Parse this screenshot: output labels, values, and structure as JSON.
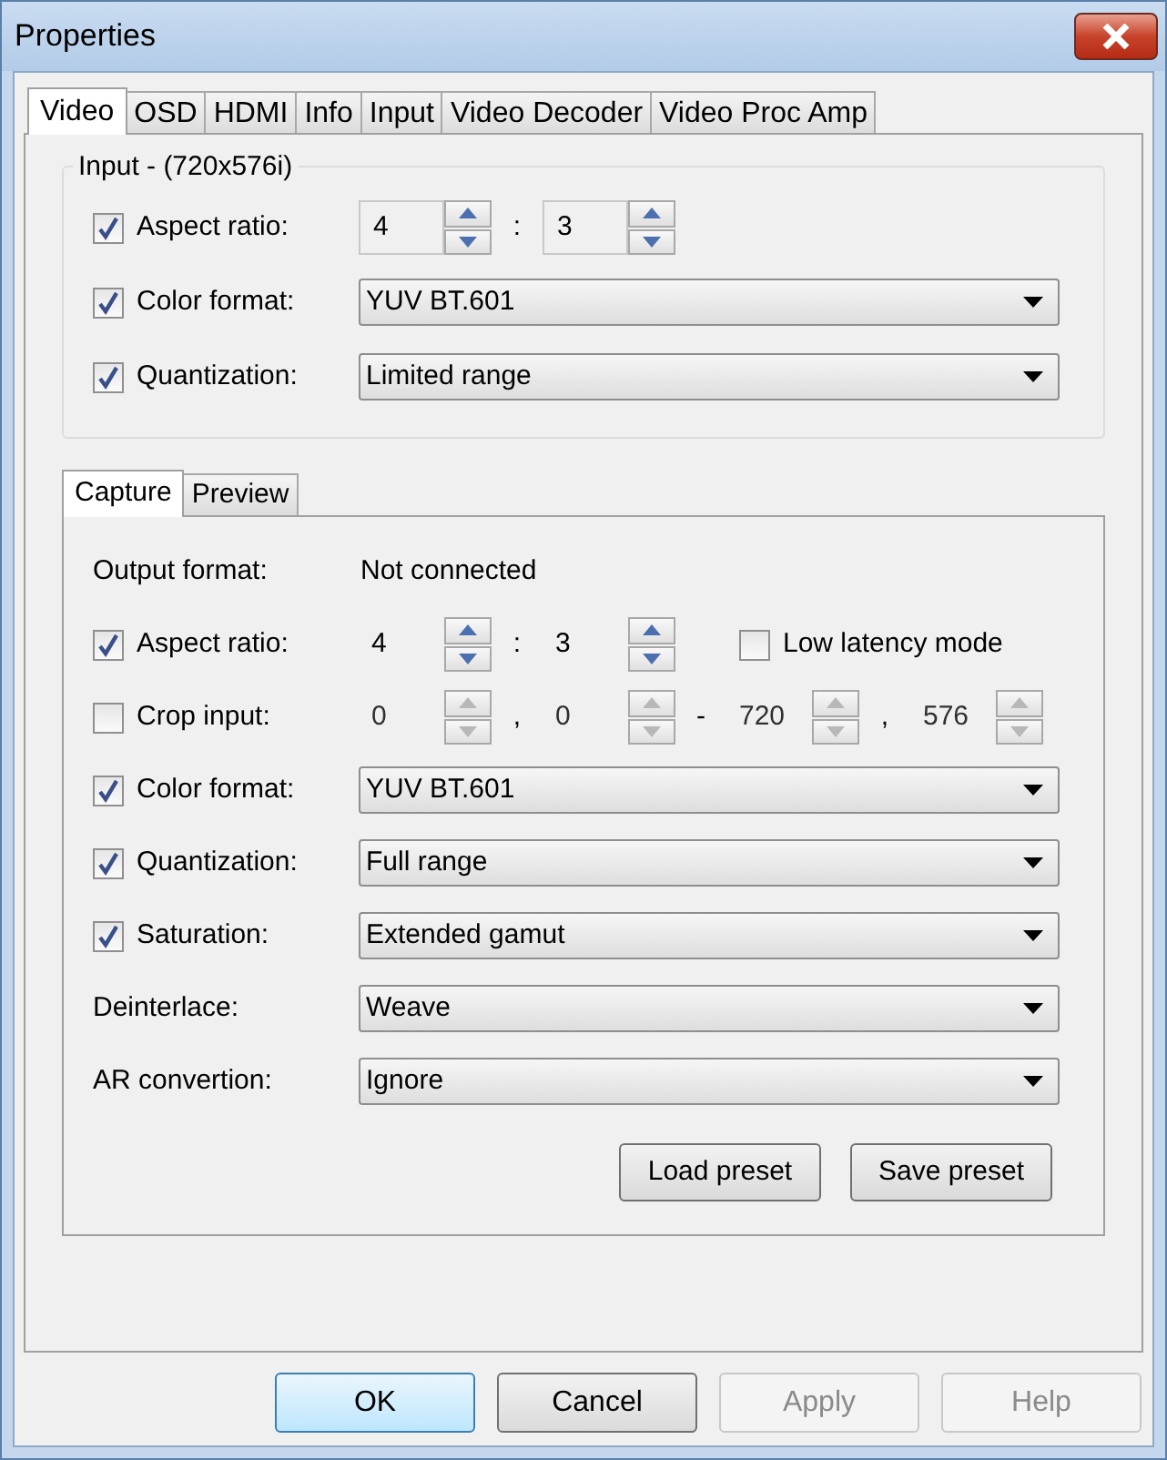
{
  "window": {
    "title": "Properties"
  },
  "tabs": [
    {
      "label": "Video",
      "selected": true
    },
    {
      "label": "OSD",
      "selected": false
    },
    {
      "label": "HDMI",
      "selected": false
    },
    {
      "label": "Info",
      "selected": false
    },
    {
      "label": "Input",
      "selected": false
    },
    {
      "label": "Video Decoder",
      "selected": false
    },
    {
      "label": "Video Proc Amp",
      "selected": false
    }
  ],
  "input_group": {
    "title": "Input - (720x576i)",
    "rows": [
      {
        "kind": "spin",
        "label": "Aspect ratio:",
        "checked": true,
        "spins": [
          {
            "value": "4",
            "disabled": false
          },
          {
            "value": "3",
            "disabled": false
          }
        ],
        "separators": [
          ":"
        ]
      },
      {
        "kind": "dropdown",
        "label": "Color format:",
        "checked": true,
        "value": "YUV BT.601"
      },
      {
        "kind": "dropdown",
        "label": "Quantization:",
        "checked": true,
        "value": "Limited range"
      }
    ]
  },
  "inner_tabs": [
    {
      "label": "Capture",
      "selected": true
    },
    {
      "label": "Preview",
      "selected": false
    }
  ],
  "capture": {
    "rows": [
      {
        "kind": "text",
        "label": "Output format:",
        "value": "Not connected"
      },
      {
        "kind": "spin",
        "label": "Aspect ratio:",
        "checked": true,
        "spins": [
          {
            "value": "4",
            "disabled": false
          },
          {
            "value": "3",
            "disabled": false
          }
        ],
        "separators": [
          ":"
        ],
        "option": {
          "label": "Low latency mode",
          "checked": false
        }
      },
      {
        "kind": "spin",
        "label": "Crop input:",
        "checked": false,
        "spins": [
          {
            "value": "0",
            "disabled": true
          },
          {
            "value": "0",
            "disabled": true
          },
          {
            "value": "720",
            "disabled": true
          },
          {
            "value": "576",
            "disabled": true
          }
        ],
        "separators": [
          ",",
          "-",
          ","
        ]
      },
      {
        "kind": "dropdown",
        "label": "Color format:",
        "checked": true,
        "value": "YUV BT.601"
      },
      {
        "kind": "dropdown",
        "label": "Quantization:",
        "checked": true,
        "value": "Full range"
      },
      {
        "kind": "dropdown",
        "label": "Saturation:",
        "checked": true,
        "value": "Extended gamut"
      },
      {
        "kind": "dropdown",
        "label": "Deinterlace:",
        "value": "Weave"
      },
      {
        "kind": "dropdown",
        "label": "AR convertion:",
        "value": "Ignore"
      }
    ],
    "buttons": [
      "Load preset",
      "Save preset"
    ]
  },
  "buttons": [
    {
      "label": "OK",
      "default": true,
      "disabled": false
    },
    {
      "label": "Cancel",
      "default": false,
      "disabled": false
    },
    {
      "label": "Apply",
      "default": false,
      "disabled": true
    },
    {
      "label": "Help",
      "default": false,
      "disabled": true
    }
  ]
}
